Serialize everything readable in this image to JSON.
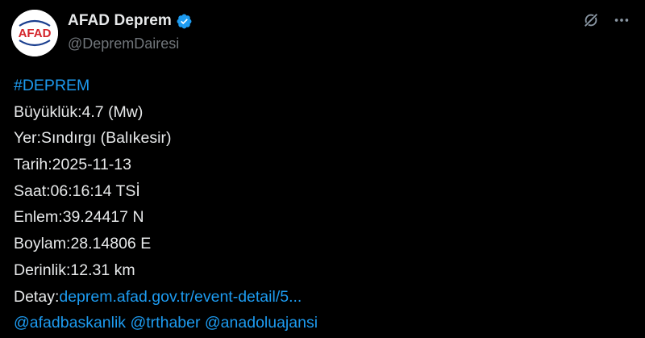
{
  "author": {
    "display_name": "AFAD Deprem",
    "handle": "@DepremDairesi",
    "avatar_text": "AFAD",
    "verified": true
  },
  "icons": {
    "verified": "verified-badge-icon",
    "grok": "grok-icon",
    "more": "more-options-icon"
  },
  "colors": {
    "background": "#000000",
    "text": "#e7e9ea",
    "secondary": "#71767b",
    "link": "#1d9bf0",
    "avatar_red": "#d4242a",
    "avatar_blue": "#1b3f8f"
  },
  "post": {
    "hashtag": "#DEPREM",
    "magnitude": "Büyüklük:4.7 (Mw)",
    "location": "Yer:Sındırgı (Balıkesir)",
    "date": "Tarih:2025-11-13",
    "time": "Saat:06:16:14 TSİ",
    "latitude": "Enlem:39.24417 N",
    "longitude": "Boylam:28.14806 E",
    "depth": "Derinlik:12.31 km",
    "detail_label": "Detay:",
    "detail_link": "deprem.afad.gov.tr/event-detail/5...",
    "mentions": [
      "@afadbaskanlik",
      "@trthaber",
      "@anadoluajansi"
    ]
  }
}
